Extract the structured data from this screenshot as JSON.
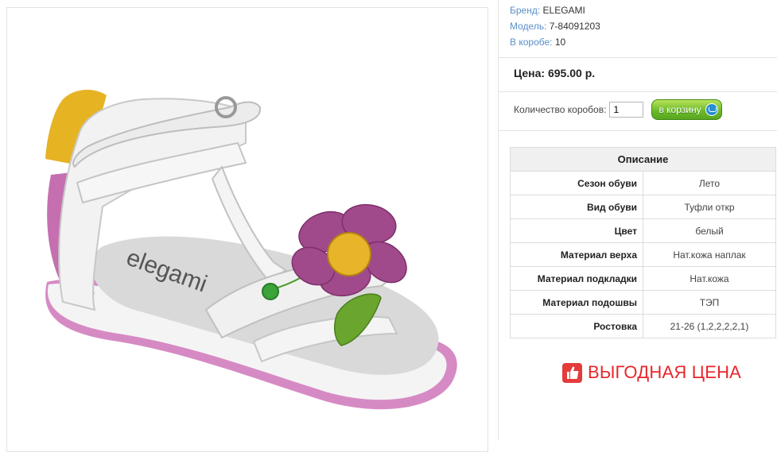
{
  "product": {
    "image_alt": "elegami",
    "brand_label": "Бренд:",
    "brand_value": "ELEGAMI",
    "model_label": "Модель:",
    "model_value": "7-84091203",
    "box_label": "В коробе:",
    "box_value": "10"
  },
  "price": {
    "text": "Цена: 695.00 р."
  },
  "order": {
    "qty_label": "Количество коробов:",
    "qty_value": "1",
    "cart_label": "в корзину"
  },
  "description": {
    "title": "Описание",
    "rows": [
      {
        "key": "Сезон обуви",
        "value": "Лето"
      },
      {
        "key": "Вид обуви",
        "value": "Туфли откр"
      },
      {
        "key": "Цвет",
        "value": "белый"
      },
      {
        "key": "Материал верха",
        "value": "Нат.кожа наплак"
      },
      {
        "key": "Материал подкладки",
        "value": "Нат.кожа"
      },
      {
        "key": "Материал подошвы",
        "value": "ТЭП"
      },
      {
        "key": "Ростовка",
        "value": "21-26 (1,2,2,2,2,1)"
      }
    ]
  },
  "promo": {
    "text": "ВЫГОДНАЯ ЦЕНА",
    "icon": "thumbs-up-icon"
  },
  "colors": {
    "link_blue": "#5b8fc9",
    "cart_green": "#6dbb2a",
    "promo_red": "#e8262b"
  }
}
